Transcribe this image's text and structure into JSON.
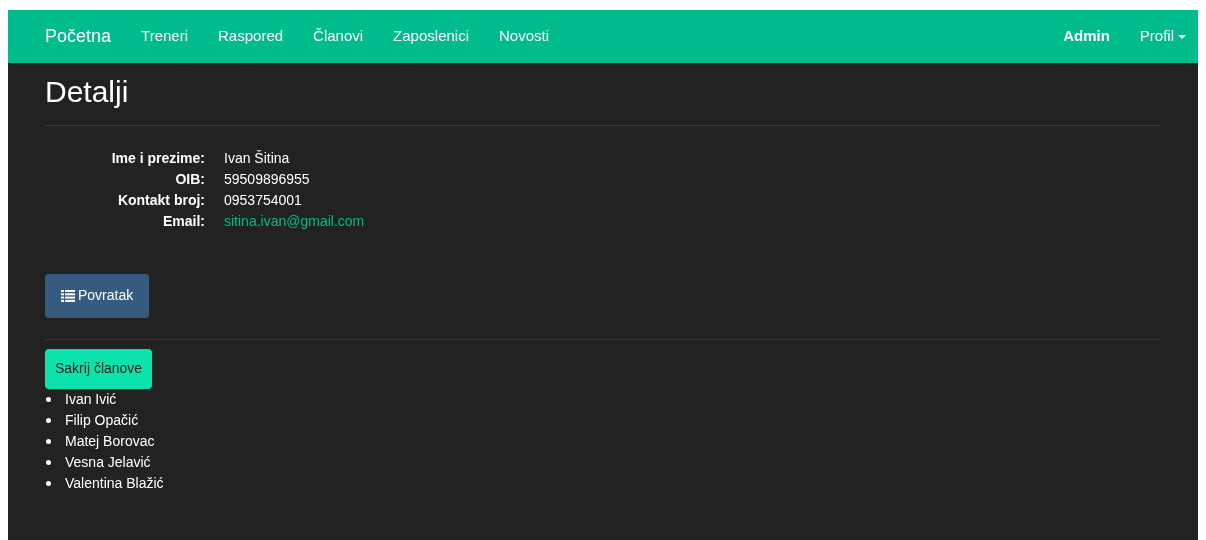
{
  "navbar": {
    "brand": "Početna",
    "links": [
      "Treneri",
      "Raspored",
      "Članovi",
      "Zaposlenici",
      "Novosti"
    ],
    "user": "Admin",
    "profile": "Profil"
  },
  "heading": "Detalji",
  "details": [
    {
      "label": "Ime i prezime:",
      "value": "Ivan Šitina",
      "kind": "text"
    },
    {
      "label": "OIB:",
      "value": "59509896955",
      "kind": "text"
    },
    {
      "label": "Kontakt broj:",
      "value": "0953754001",
      "kind": "text"
    },
    {
      "label": "Email:",
      "value": "sitina.ivan@gmail.com",
      "kind": "link"
    }
  ],
  "back_button": "Povratak",
  "toggle_button": "Sakrij članove",
  "members": [
    "Ivan Ivić",
    "Filip Opačić",
    "Matej Borovac",
    "Vesna Jelavić",
    "Valentina Blažić"
  ]
}
